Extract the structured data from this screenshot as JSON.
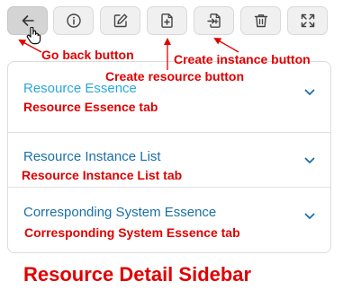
{
  "toolbar": {
    "buttons": [
      {
        "icon": "arrow-left-icon",
        "state": "pressed"
      },
      {
        "icon": "info-icon"
      },
      {
        "icon": "edit-icon"
      },
      {
        "icon": "file-plus-icon"
      },
      {
        "icon": "file-import-icon"
      },
      {
        "icon": "trash-icon"
      },
      {
        "icon": "expand-icon"
      }
    ]
  },
  "tabs": [
    {
      "label": "Resource Essence",
      "color": "#2aa8d8",
      "icon": "chevron-down-icon"
    },
    {
      "label": "Resource Instance List",
      "color": "#1a6fa8",
      "icon": "chevron-down-icon"
    },
    {
      "label": "Corresponding System Essence",
      "color": "#1a6fa8",
      "icon": "chevron-down-icon"
    }
  ],
  "annotations": {
    "go_back": "Go back button",
    "create_resource": "Create resource button",
    "create_instance": "Create instance button",
    "tab1": "Resource Essence tab",
    "tab2": "Resource Instance List tab",
    "tab3": "Corresponding System Essence tab",
    "caption": "Resource Detail Sidebar"
  },
  "colors": {
    "annotation": "#e00000",
    "icon": "#444444",
    "chevron": "#1a6fa8"
  }
}
